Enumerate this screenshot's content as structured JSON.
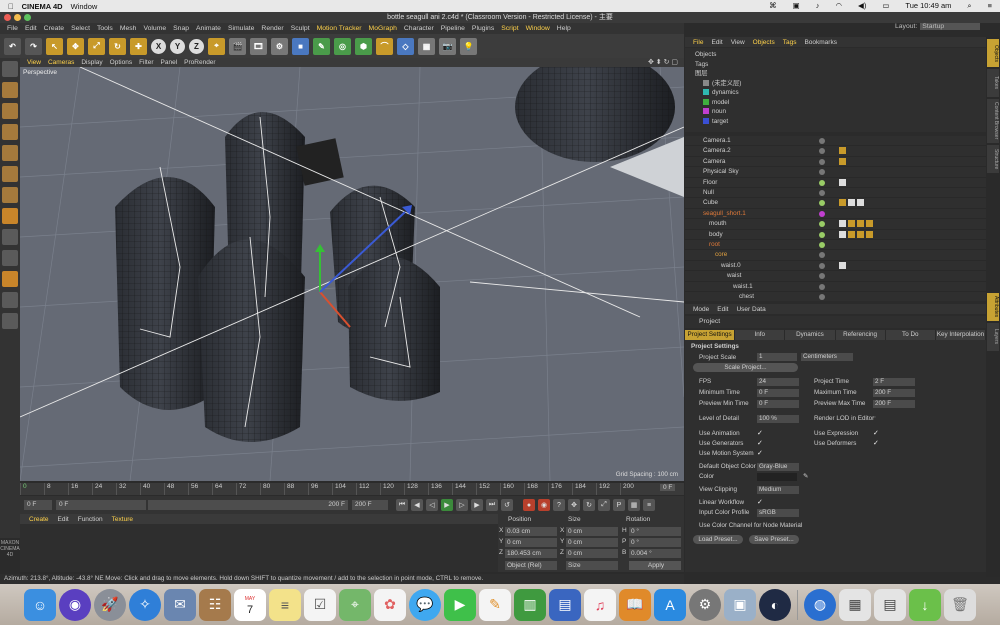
{
  "mac_menubar": {
    "apple": "",
    "app": "CINEMA 4D",
    "window": "Window",
    "clock": "Tue 10:49 am",
    "icons": [
      "control-icon",
      "cube-icon",
      "music-icon",
      "wifi-icon",
      "volume-icon",
      "battery-icon",
      "search-icon",
      "list-icon"
    ]
  },
  "window_title": "bottle seagull ani 2.c4d * (Classroom Version - Restricted License) - 主要",
  "c4d_menu": [
    "File",
    "Edit",
    "Create",
    "Select",
    "Tools",
    "Mesh",
    "Volume",
    "Snap",
    "Animate",
    "Simulate",
    "Render",
    "Sculpt",
    "Motion Tracker",
    "MoGraph",
    "Character",
    "Pipeline",
    "Plugins",
    "Script",
    "Window",
    "Help"
  ],
  "layout": {
    "label": "Layout:",
    "value": "Startup"
  },
  "toolbar": {
    "axis_x": "X",
    "axis_y": "Y",
    "axis_z": "Z"
  },
  "viewport": {
    "menu": [
      "View",
      "Cameras",
      "Display",
      "Options",
      "Filter",
      "Panel",
      "ProRender"
    ],
    "name": "Perspective",
    "grid_spacing": "Grid Spacing : 100 cm"
  },
  "timeline": {
    "ticks": [
      "0",
      "8",
      "16",
      "24",
      "32",
      "40",
      "48",
      "56",
      "64",
      "72",
      "80",
      "88",
      "96",
      "104",
      "112",
      "120",
      "128",
      "136",
      "144",
      "152",
      "160",
      "168",
      "176",
      "184",
      "192",
      "200"
    ],
    "current": "0 F"
  },
  "transport": {
    "start": "0 F",
    "field2": "0 F",
    "end_a": "200 F",
    "end_b": "200 F"
  },
  "material_menu": [
    "Create",
    "Edit",
    "Function",
    "Texture"
  ],
  "maxon": "MAXON CINEMA 4D",
  "coordinates": {
    "headers": {
      "position": "Position",
      "size": "Size",
      "rotation": "Rotation"
    },
    "rows": [
      {
        "a": "X",
        "pos": "0.03 cm",
        "b": "X",
        "size": "0 cm",
        "c": "H",
        "rot": "0 °"
      },
      {
        "a": "Y",
        "pos": "0 cm",
        "b": "Y",
        "size": "0 cm",
        "c": "P",
        "rot": "0 °"
      },
      {
        "a": "Z",
        "pos": "180.453 cm",
        "b": "Z",
        "size": "0 cm",
        "c": "B",
        "rot": "0.004 °"
      }
    ],
    "mode": "Object (Rel)",
    "size_mode": "Size",
    "apply": "Apply"
  },
  "status": "Azimuth: 213.8°, Altitude: -43.8°  NE     Move: Click and drag to move elements. Hold down SHIFT to quantize movement / add to the selection in point mode, CTRL to remove.",
  "objects_menu": [
    "File",
    "Edit",
    "View",
    "Objects",
    "Tags",
    "Bookmarks"
  ],
  "layers": [
    {
      "name": "Objects",
      "color": ""
    },
    {
      "name": "Tags",
      "color": ""
    },
    {
      "name": "图层",
      "color": ""
    },
    {
      "name": "(未定义层)",
      "color": "#888888"
    },
    {
      "name": "dynamics",
      "color": "#2fb9b0"
    },
    {
      "name": "model",
      "color": "#3fae3f"
    },
    {
      "name": "noun",
      "color": "#c13fd0"
    },
    {
      "name": "target",
      "color": "#3a4fd4"
    }
  ],
  "objects": [
    {
      "name": "Camera.1",
      "indent": 0,
      "color": "#cfcfcf"
    },
    {
      "name": "Camera.2",
      "indent": 0,
      "color": "#cfcfcf"
    },
    {
      "name": "Camera",
      "indent": 0,
      "color": "#cfcfcf"
    },
    {
      "name": "Physical Sky",
      "indent": 0,
      "color": "#cfcfcf"
    },
    {
      "name": "Floor",
      "indent": 0,
      "color": "#cfcfcf"
    },
    {
      "name": "Null",
      "indent": 0,
      "color": "#cfcfcf"
    },
    {
      "name": "Cube",
      "indent": 0,
      "color": "#cfcfcf"
    },
    {
      "name": "seagull_short.1",
      "indent": 0,
      "color": "#e07a3a"
    },
    {
      "name": "mouth",
      "indent": 1,
      "color": "#cfcfcf"
    },
    {
      "name": "body",
      "indent": 1,
      "color": "#cfcfcf"
    },
    {
      "name": "root",
      "indent": 1,
      "color": "#e07a3a"
    },
    {
      "name": "core",
      "indent": 2,
      "color": "#e0a040"
    },
    {
      "name": "waist.0",
      "indent": 3,
      "color": "#cfcfcf"
    },
    {
      "name": "waist",
      "indent": 4,
      "color": "#cfcfcf"
    },
    {
      "name": "waist.1",
      "indent": 5,
      "color": "#cfcfcf"
    },
    {
      "name": "chest",
      "indent": 6,
      "color": "#cfcfcf"
    }
  ],
  "attr_menu": [
    "Mode",
    "Edit",
    "User Data"
  ],
  "attr_title": "Project",
  "attr_tabs": [
    "Project Settings",
    "Info",
    "Dynamics",
    "Referencing",
    "To Do",
    "Key Interpolation"
  ],
  "project": {
    "section": "Project Settings",
    "scale_label": "Project Scale",
    "scale_value": "1",
    "scale_unit": "Centimeters",
    "scale_btn": "Scale Project...",
    "fps_label": "FPS",
    "fps": "24",
    "ptime_label": "Project Time",
    "ptime": "2 F",
    "mintime_label": "Minimum Time",
    "mintime": "0 F",
    "maxtime_label": "Maximum Time",
    "maxtime": "200 F",
    "pmin_label": "Preview Min Time",
    "pmin": "0 F",
    "pmax_label": "Preview Max Time",
    "pmax": "200 F",
    "lod_label": "Level of Detail",
    "lod": "100 %",
    "rlod_label": "Render LOD in Editor",
    "useanim": "Use Animation",
    "useexpr": "Use Expression",
    "usegen": "Use Generators",
    "usedef": "Use Deformers",
    "usemotion": "Use Motion System",
    "defcolor_label": "Default Object Color",
    "defcolor": "Gray-Blue",
    "color_label": "Color",
    "clip_label": "View Clipping",
    "clip": "Medium",
    "linear_label": "Linear Workflow",
    "profile_label": "Input Color Profile",
    "profile": "sRGB",
    "nodemat": "Use Color Channel for Node Material",
    "load": "Load Preset...",
    "save": "Save Preset..."
  },
  "side_tabs": [
    "Objects",
    "Takes",
    "Content Browser",
    "Structure",
    "Attributes",
    "Layers"
  ],
  "dock": [
    "Finder",
    "Siri",
    "Launchpad",
    "Safari",
    "Mail",
    "Contacts",
    "Calendar",
    "Notes",
    "Reminders",
    "Maps",
    "Photos",
    "Messages",
    "FaceTime",
    "Pages",
    "Numbers",
    "Keynote",
    "Music",
    "Books",
    "App Store",
    "System Preferences",
    "Preview",
    "Cinema 4D",
    "Globe",
    "News",
    "Stickies",
    "Trash"
  ],
  "dock_calendar_day": "7",
  "dock_calendar_month": "MAY"
}
